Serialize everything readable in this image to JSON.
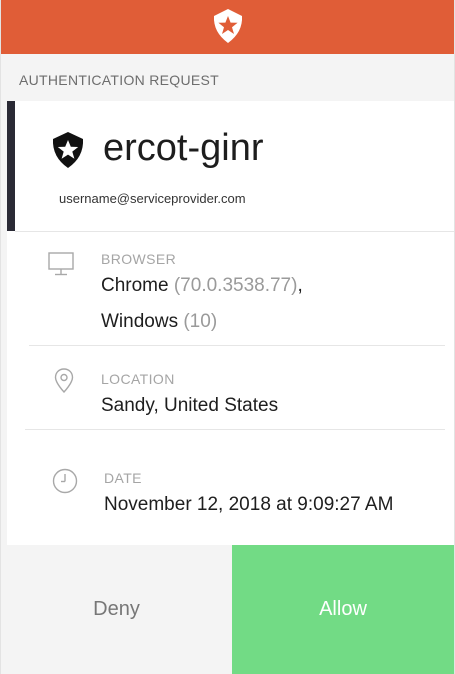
{
  "section_label": "AUTHENTICATION REQUEST",
  "app": {
    "name": "ercot-ginr",
    "username": "username@serviceprovider.com",
    "logo_icon": "auth0-star-shield-icon"
  },
  "details": {
    "browser": {
      "label": "BROWSER",
      "name": "Chrome",
      "version": "(70.0.3538.77)",
      "separator": ",",
      "os": "Windows",
      "os_version": "(10)",
      "icon": "monitor-icon"
    },
    "location": {
      "label": "LOCATION",
      "value": "Sandy, United States",
      "icon": "location-pin-icon"
    },
    "date": {
      "label": "DATE",
      "value": "November 12, 2018 at 9:09:27 AM",
      "icon": "clock-icon"
    }
  },
  "actions": {
    "deny_label": "Deny",
    "allow_label": "Allow"
  },
  "colors": {
    "header": "#e05d37",
    "allow": "#72db85",
    "accent_bar": "#2a2a35"
  }
}
